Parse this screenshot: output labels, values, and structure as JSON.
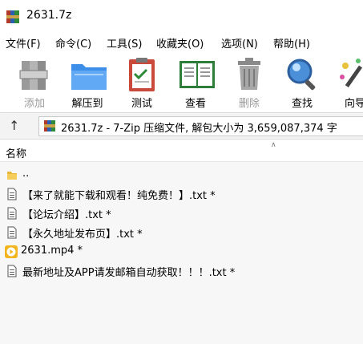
{
  "window": {
    "title": "2631.7z"
  },
  "menu": [
    {
      "label": "文件(F)"
    },
    {
      "label": "命令(C)"
    },
    {
      "label": "工具(S)"
    },
    {
      "label": "收藏夹(O)"
    },
    {
      "label": "选项(N)"
    },
    {
      "label": "帮助(H)"
    }
  ],
  "toolbar": {
    "add": "添加",
    "extract": "解压到",
    "test": "测试",
    "view": "查看",
    "delete": "删除",
    "find": "查找",
    "wizard": "向导"
  },
  "address": {
    "text": "2631.7z - 7-Zip 压缩文件, 解包大小为 3,659,087,374 字"
  },
  "list": {
    "column_name": "名称",
    "items": [
      {
        "name": "..",
        "icon": "folder-icon"
      },
      {
        "name": "【来了就能下载和观看！纯免费！】.txt *",
        "icon": "text-file-icon"
      },
      {
        "name": "【论坛介绍】.txt *",
        "icon": "text-file-icon"
      },
      {
        "name": "【永久地址发布页】.txt *",
        "icon": "text-file-icon"
      },
      {
        "name": "2631.mp4 *",
        "icon": "video-file-icon"
      },
      {
        "name": "最新地址及APP请发邮箱自动获取！！！.txt *",
        "icon": "text-file-icon"
      }
    ]
  }
}
